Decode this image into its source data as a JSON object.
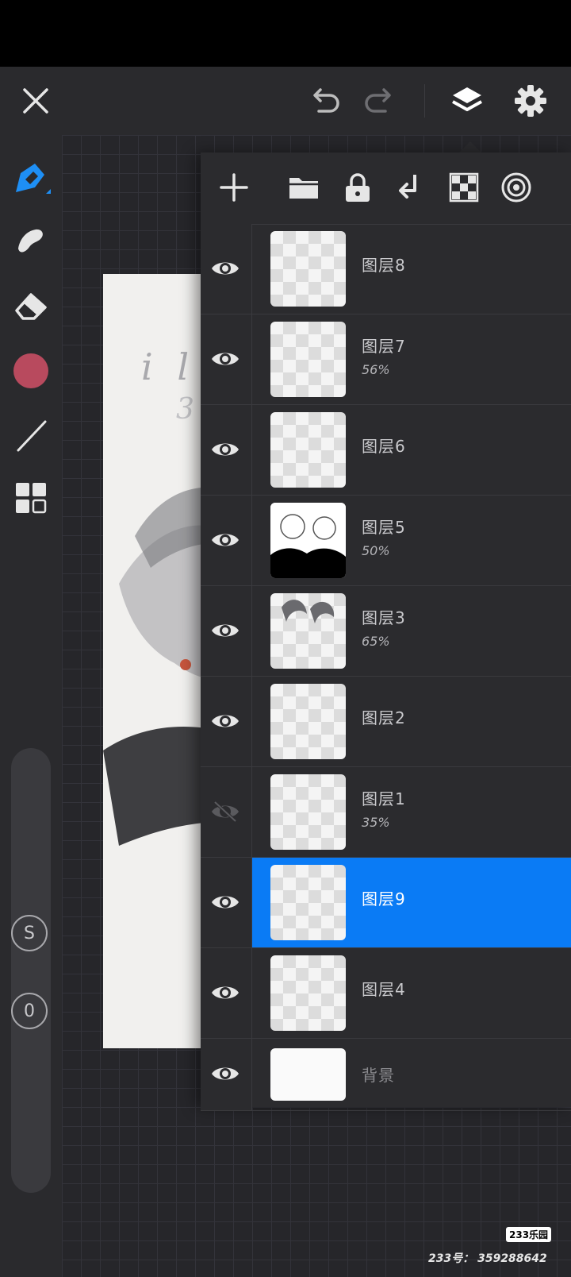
{
  "layers": [
    {
      "name": "图层8",
      "opacity": "",
      "visible": true,
      "selected": false
    },
    {
      "name": "图层7",
      "opacity": "56%",
      "visible": true,
      "selected": false
    },
    {
      "name": "图层6",
      "opacity": "",
      "visible": true,
      "selected": false
    },
    {
      "name": "图层5",
      "opacity": "50%",
      "visible": true,
      "selected": false
    },
    {
      "name": "图层3",
      "opacity": "65%",
      "visible": true,
      "selected": false
    },
    {
      "name": "图层2",
      "opacity": "",
      "visible": true,
      "selected": false
    },
    {
      "name": "图层1",
      "opacity": "35%",
      "visible": false,
      "selected": false
    },
    {
      "name": "图层9",
      "opacity": "",
      "visible": true,
      "selected": true
    },
    {
      "name": "图层4",
      "opacity": "",
      "visible": true,
      "selected": false
    },
    {
      "name": "背景",
      "opacity": "",
      "visible": true,
      "selected": false
    }
  ],
  "left_toolbar": {
    "color": "#b84a5e",
    "s_button": "S",
    "zero_button": "0"
  },
  "colors": {
    "accent": "#0a7bf5"
  },
  "canvas": {
    "title_text": "i l l",
    "sub_text": "3"
  },
  "watermark": {
    "logo": "233乐园",
    "text": "233号： 359288642"
  }
}
